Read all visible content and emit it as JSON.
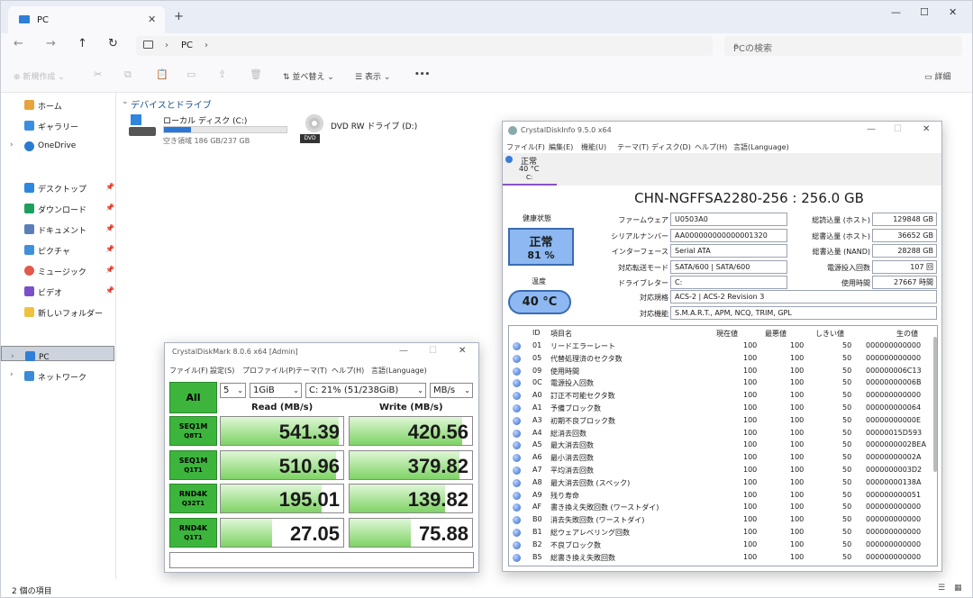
{
  "explorer": {
    "tab_label": "PC",
    "address": [
      "PC"
    ],
    "search_placeholder": "PCの検索",
    "toolbar": {
      "new": "新規作成",
      "sort": "並べ替え",
      "view": "表示",
      "more": "•••",
      "details": "詳細"
    },
    "sidebar": {
      "home": "ホーム",
      "gallery": "ギャラリー",
      "onedrive": "OneDrive",
      "desktop": "デスクトップ",
      "downloads": "ダウンロード",
      "documents": "ドキュメント",
      "pictures": "ピクチャ",
      "music": "ミュージック",
      "videos": "ビデオ",
      "newfolder": "新しいフォルダー",
      "pc": "PC",
      "network": "ネットワーク"
    },
    "section_header": "デバイスとドライブ",
    "drives": [
      {
        "name": "ローカル ディスク (C:)",
        "free": "空き領域 186 GB/237 GB",
        "used_fraction": 0.22
      },
      {
        "name": "DVD RW ドライブ (D:)",
        "label": "DVD"
      }
    ],
    "status": "2 個の項目"
  },
  "cdi": {
    "title": "CrystalDiskInfo 9.5.0 x64",
    "menu": [
      "ファイル(F)",
      "編集(E)",
      "機能(U)",
      "テーマ(T)",
      "ディスク(D)",
      "ヘルプ(H)",
      "言語(Language)"
    ],
    "disk_tab": {
      "status": "正常",
      "temp": "40 °C",
      "drive": "C:"
    },
    "model": "CHN-NGFFSA2280-256 : 256.0 GB",
    "health_label": "健康状態",
    "health_status": "正常",
    "health_pct": "81 %",
    "temp_label": "温度",
    "temp_value": "40 °C",
    "left_fields": [
      {
        "k": "ファームウェア",
        "v": "U0503A0"
      },
      {
        "k": "シリアルナンバー",
        "v": "AA000000000000001320"
      },
      {
        "k": "インターフェース",
        "v": "Serial ATA"
      },
      {
        "k": "対応転送モード",
        "v": "SATA/600 | SATA/600"
      },
      {
        "k": "ドライブレター",
        "v": "C:"
      }
    ],
    "right_fields": [
      {
        "k": "総読込量 (ホスト)",
        "v": "129848 GB"
      },
      {
        "k": "総書込量 (ホスト)",
        "v": "36652 GB"
      },
      {
        "k": "総書込量 (NAND)",
        "v": "28288 GB"
      },
      {
        "k": "電源投入回数",
        "v": "107 回"
      },
      {
        "k": "使用時間",
        "v": "27667 時間"
      }
    ],
    "standard_label": "対応規格",
    "standard": "ACS-2 | ACS-2 Revision 3",
    "features_label": "対応機能",
    "features": "S.M.A.R.T., APM, NCQ, TRIM, GPL",
    "smart_headers": [
      "ID",
      "項目名",
      "現在値",
      "最悪値",
      "しきい値",
      "生の値"
    ],
    "smart": [
      [
        "01",
        "リードエラーレート",
        "100",
        "100",
        "50",
        "000000000000"
      ],
      [
        "05",
        "代替処理済のセクタ数",
        "100",
        "100",
        "50",
        "000000000000"
      ],
      [
        "09",
        "使用時間",
        "100",
        "100",
        "50",
        "000000006C13"
      ],
      [
        "0C",
        "電源投入回数",
        "100",
        "100",
        "50",
        "00000000006B"
      ],
      [
        "A0",
        "訂正不可能セクタ数",
        "100",
        "100",
        "50",
        "000000000000"
      ],
      [
        "A1",
        "予備ブロック数",
        "100",
        "100",
        "50",
        "000000000064"
      ],
      [
        "A3",
        "初期不良ブロック数",
        "100",
        "100",
        "50",
        "00000000000E"
      ],
      [
        "A4",
        "総消去回数",
        "100",
        "100",
        "50",
        "00000015D593"
      ],
      [
        "A5",
        "最大消去回数",
        "100",
        "100",
        "50",
        "0000000002BEA"
      ],
      [
        "A6",
        "最小消去回数",
        "100",
        "100",
        "50",
        "00000000002A"
      ],
      [
        "A7",
        "平均消去回数",
        "100",
        "100",
        "50",
        "0000000003D2"
      ],
      [
        "A8",
        "最大消去回数 (スペック)",
        "100",
        "100",
        "50",
        "00000000138A"
      ],
      [
        "A9",
        "残り寿命",
        "100",
        "100",
        "50",
        "000000000051"
      ],
      [
        "AF",
        "書き換え失敗回数 (ワーストダイ)",
        "100",
        "100",
        "50",
        "000000000000"
      ],
      [
        "B0",
        "消去失敗回数 (ワーストダイ)",
        "100",
        "100",
        "50",
        "000000000000"
      ],
      [
        "B1",
        "総ウェアレベリング回数",
        "100",
        "100",
        "50",
        "000000000000"
      ],
      [
        "B2",
        "不良ブロック数",
        "100",
        "100",
        "50",
        "000000000000"
      ],
      [
        "B5",
        "総書き換え失敗回数",
        "100",
        "100",
        "50",
        "000000000000"
      ]
    ]
  },
  "cdm": {
    "title": "CrystalDiskMark 8.0.6 x64 [Admin]",
    "menu": [
      "ファイル(F)",
      "設定(S)",
      "プロファイル(P)",
      "テーマ(T)",
      "ヘルプ(H)",
      "言語(Language)"
    ],
    "all": "All",
    "count": "5",
    "size": "1GiB",
    "drive": "C: 21% (51/238GiB)",
    "unit": "MB/s",
    "read_header": "Read (MB/s)",
    "write_header": "Write (MB/s)",
    "tests": [
      {
        "l1": "SEQ1M",
        "l2": "Q8T1",
        "read": "541.39",
        "write": "420.56",
        "rf": 0.96,
        "wf": 0.92
      },
      {
        "l1": "SEQ1M",
        "l2": "Q1T1",
        "read": "510.96",
        "write": "379.82",
        "rf": 0.94,
        "wf": 0.9
      },
      {
        "l1": "RND4K",
        "l2": "Q32T1",
        "read": "195.01",
        "write": "139.82",
        "rf": 0.82,
        "wf": 0.78
      },
      {
        "l1": "RND4K",
        "l2": "Q1T1",
        "read": "27.05",
        "write": "75.88",
        "rf": 0.42,
        "wf": 0.5
      }
    ]
  }
}
